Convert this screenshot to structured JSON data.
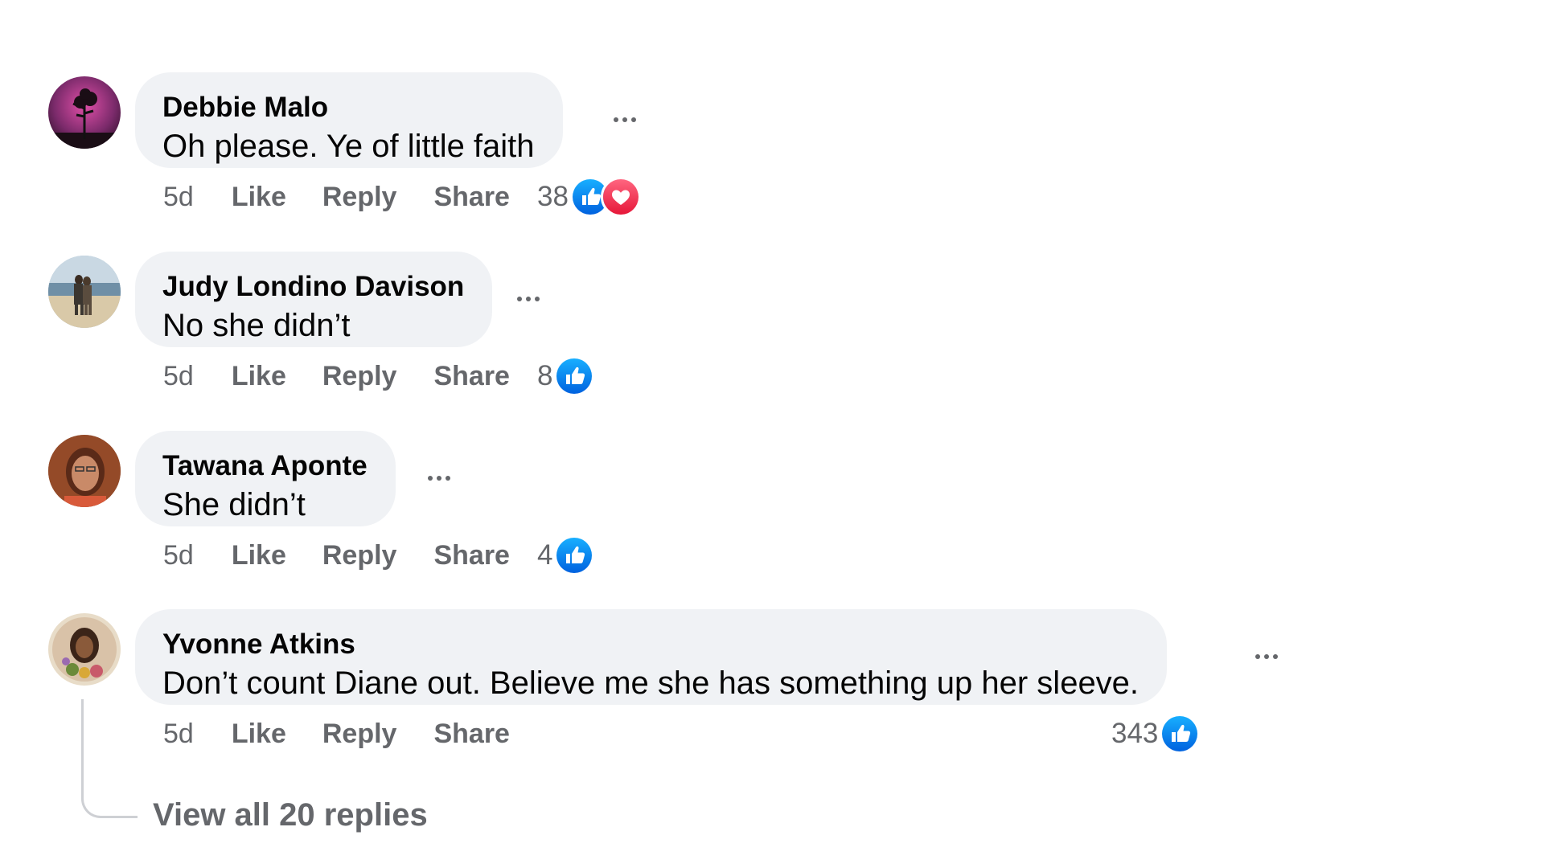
{
  "comments": [
    {
      "author": "Debbie Malo",
      "text": "Oh please. Ye of little faith",
      "time": "5d",
      "like": "Like",
      "reply": "Reply",
      "share": "Share",
      "reaction_count": "38",
      "reactions": [
        "like-icon",
        "love-icon"
      ]
    },
    {
      "author": "Judy Londino Davison",
      "text": "No she didn’t",
      "time": "5d",
      "like": "Like",
      "reply": "Reply",
      "share": "Share",
      "reaction_count": "8",
      "reactions": [
        "like-icon"
      ]
    },
    {
      "author": "Tawana Aponte",
      "text": "She didn’t",
      "time": "5d",
      "like": "Like",
      "reply": "Reply",
      "share": "Share",
      "reaction_count": "4",
      "reactions": [
        "like-icon"
      ]
    },
    {
      "author": "Yvonne Atkins",
      "text": "Don’t count Diane out. Believe me she has something up her sleeve.",
      "time": "5d",
      "like": "Like",
      "reply": "Reply",
      "share": "Share",
      "reaction_count": "343",
      "reactions": [
        "like-icon"
      ]
    }
  ],
  "view_replies": "View all 20 replies",
  "colors": {
    "like_blue": "#1877f2",
    "love_red": "#f33e58",
    "bubble": "#f0f2f5",
    "muted_text": "#65676b"
  }
}
